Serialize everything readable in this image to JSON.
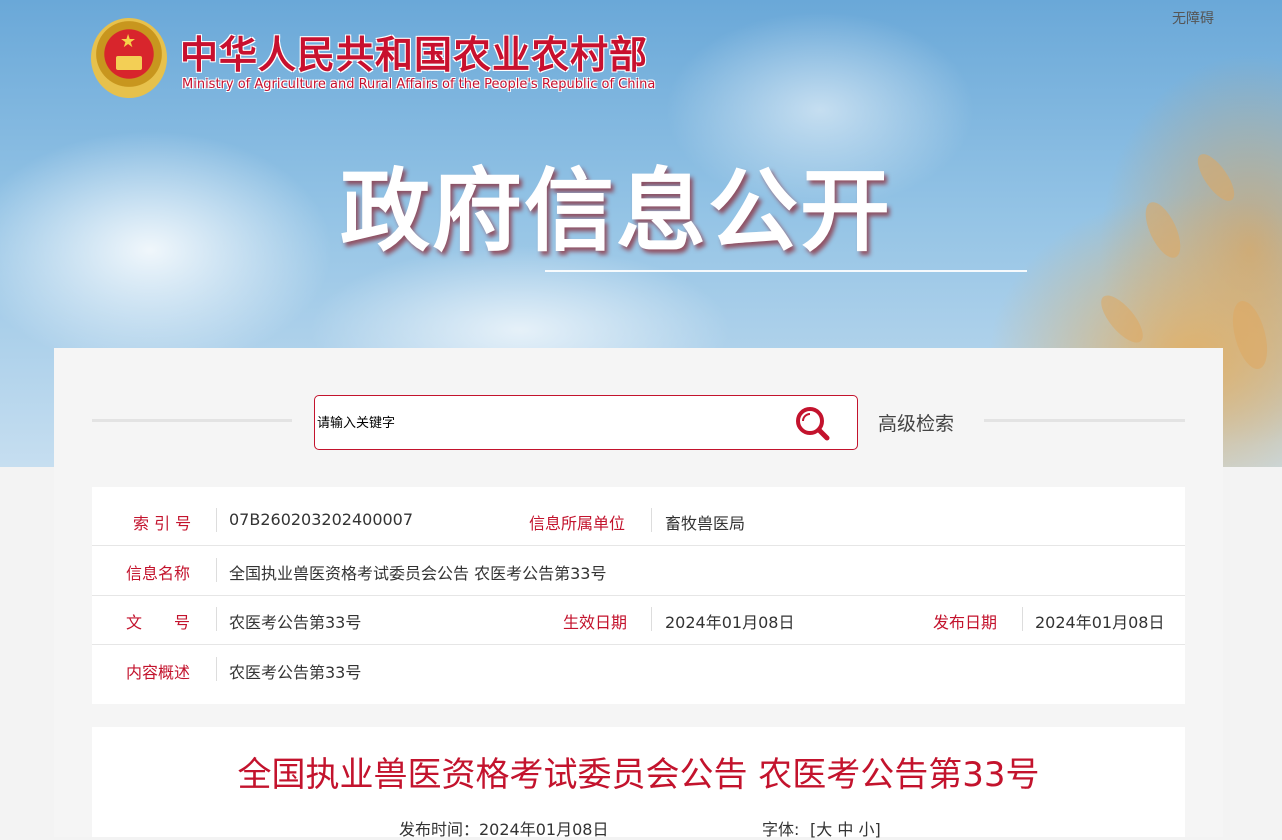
{
  "header": {
    "site_title": "中华人民共和国农业农村部",
    "site_subtitle": "Ministry of Agriculture and Rural Affairs of the People's Republic of China",
    "accessibility_link": "无障碍",
    "page_heading": "政府信息公开"
  },
  "search": {
    "placeholder": "请输入关键字",
    "advanced_label": "高级检索"
  },
  "meta": {
    "index_label": "索 引 号",
    "index_value": "07B260203202400007",
    "unit_label": "信息所属单位",
    "unit_value": "畜牧兽医局",
    "name_label": "信息名称",
    "name_value": "全国执业兽医资格考试委员会公告 农医考公告第33号",
    "doc_no_label": "文　　号",
    "doc_no_value": "农医考公告第33号",
    "effective_label": "生效日期",
    "effective_value": "2024年01月08日",
    "publish_label": "发布日期",
    "publish_value": "2024年01月08日",
    "summary_label": "内容概述",
    "summary_value": "农医考公告第33号"
  },
  "article": {
    "title": "全国执业兽医资格考试委员会公告 农医考公告第33号",
    "publish_time_label": "发布时间：",
    "publish_time_value": "2024年01月08日",
    "font_label": "字体:",
    "font_open": "[",
    "font_large": "大",
    "font_medium": "中",
    "font_small": "小",
    "font_close": "]"
  },
  "colors": {
    "accent_red": "#c3132d",
    "sky_blue": "#8fc0e3",
    "wheat_gold": "#e2b066"
  },
  "icons": {
    "emblem": "national-emblem-icon",
    "search": "search-icon"
  }
}
